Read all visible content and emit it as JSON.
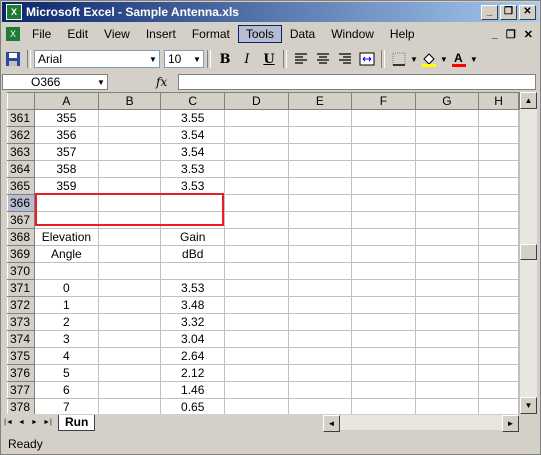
{
  "window": {
    "title": "Microsoft Excel - Sample Antenna.xls",
    "app_icon_glyph": "X",
    "minimize_glyph": "_",
    "restore_glyph": "❐",
    "close_glyph": "✕"
  },
  "menu": {
    "items": [
      "File",
      "Edit",
      "View",
      "Insert",
      "Format",
      "Tools",
      "Data",
      "Window",
      "Help"
    ],
    "active": "Tools",
    "doc_minimize_glyph": "_",
    "doc_restore_glyph": "❐",
    "doc_close_glyph": "✕"
  },
  "toolbar": {
    "font_name": "Arial",
    "font_size": "10",
    "bold": "B",
    "italic": "I",
    "underline": "U",
    "icons": [
      "save-icon",
      "align-left-icon",
      "align-center-icon",
      "align-right-icon",
      "merge-center-icon",
      "borders-icon",
      "fill-color-icon",
      "font-color-icon"
    ]
  },
  "formula_bar": {
    "name_box": "O366",
    "fx": "fx",
    "formula": ""
  },
  "sheet": {
    "columns": [
      "A",
      "B",
      "C",
      "D",
      "E",
      "F",
      "G",
      "H"
    ],
    "selected_row": "366",
    "rows": [
      {
        "num": "361",
        "A": "355",
        "B": "",
        "C": "3.55"
      },
      {
        "num": "362",
        "A": "356",
        "B": "",
        "C": "3.54"
      },
      {
        "num": "363",
        "A": "357",
        "B": "",
        "C": "3.54"
      },
      {
        "num": "364",
        "A": "358",
        "B": "",
        "C": "3.53"
      },
      {
        "num": "365",
        "A": "359",
        "B": "",
        "C": "3.53"
      },
      {
        "num": "366",
        "A": "",
        "B": "",
        "C": ""
      },
      {
        "num": "367",
        "A": "",
        "B": "",
        "C": ""
      },
      {
        "num": "368",
        "A": "Elevation",
        "B": "",
        "C": "Gain"
      },
      {
        "num": "369",
        "A": "Angle",
        "B": "",
        "C": "dBd"
      },
      {
        "num": "370",
        "A": "",
        "B": "",
        "C": ""
      },
      {
        "num": "371",
        "A": "0",
        "B": "",
        "C": "3.53"
      },
      {
        "num": "372",
        "A": "1",
        "B": "",
        "C": "3.48"
      },
      {
        "num": "373",
        "A": "2",
        "B": "",
        "C": "3.32"
      },
      {
        "num": "374",
        "A": "3",
        "B": "",
        "C": "3.04"
      },
      {
        "num": "375",
        "A": "4",
        "B": "",
        "C": "2.64"
      },
      {
        "num": "376",
        "A": "5",
        "B": "",
        "C": "2.12"
      },
      {
        "num": "377",
        "A": "6",
        "B": "",
        "C": "1.46"
      },
      {
        "num": "378",
        "A": "7",
        "B": "",
        "C": "0.65"
      }
    ]
  },
  "tabs": {
    "nav": [
      "|◄",
      "◄",
      "►",
      "►|"
    ],
    "sheets": [
      "Run"
    ]
  },
  "status": {
    "text": "Ready"
  },
  "colors": {
    "highlight_box": "#e81e24",
    "title_bar": "#0a246a"
  }
}
